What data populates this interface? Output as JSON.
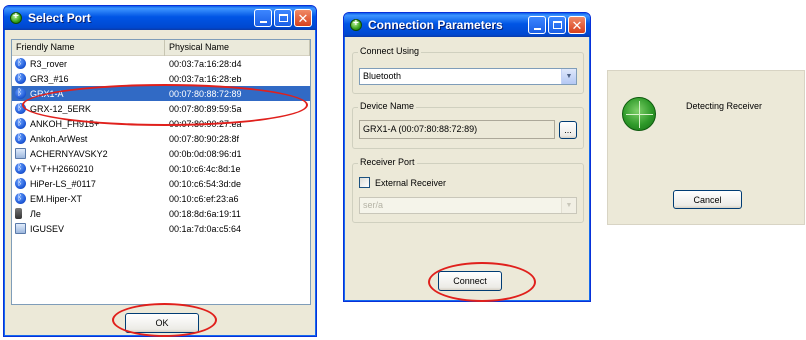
{
  "select_port": {
    "title": "Select Port",
    "columns": [
      "Friendly Name",
      "Physical Name"
    ],
    "rows": [
      {
        "name": "R3_rover",
        "addr": "00:03:7a:16:28:d4",
        "icon": "bluetooth-icon"
      },
      {
        "name": "GR3_#16",
        "addr": "00:03:7a:16:28:eb",
        "icon": "bluetooth-icon"
      },
      {
        "name": "GRX1-A",
        "addr": "00:07:80:88:72:89",
        "icon": "bluetooth-icon",
        "selected": true
      },
      {
        "name": "GRX-12_5ERK",
        "addr": "00:07:80:89:59:5a",
        "icon": "bluetooth-icon"
      },
      {
        "name": "ANKOH_FH915+",
        "addr": "00:07:80:90:27:ea",
        "icon": "bluetooth-icon"
      },
      {
        "name": "Ankoh.ArWest",
        "addr": "00:07:80:90:28:8f",
        "icon": "bluetooth-icon"
      },
      {
        "name": "ACHERNYAVSKY2",
        "addr": "00:0b:0d:08:96:d1",
        "icon": "computer-icon"
      },
      {
        "name": "V+T+H2660210",
        "addr": "00:10:c6:4c:8d:1e",
        "icon": "bluetooth-icon"
      },
      {
        "name": "HiPer-LS_#0117",
        "addr": "00:10:c6:54:3d:de",
        "icon": "bluetooth-icon"
      },
      {
        "name": "EM.Hiper-XT",
        "addr": "00:10:c6:ef:23:a6",
        "icon": "bluetooth-icon"
      },
      {
        "name": "Лe",
        "addr": "00:18:8d:6a:19:11",
        "icon": "phone-icon"
      },
      {
        "name": "IGUSEV",
        "addr": "00:1a:7d:0a:c5:64",
        "icon": "computer-icon"
      }
    ],
    "ok_label": "OK"
  },
  "connection_parameters": {
    "title": "Connection Parameters",
    "connect_using_label": "Connect Using",
    "connect_using_value": "Bluetooth",
    "device_name_label": "Device Name",
    "device_name_value": "GRX1-A (00:07:80:88:72:89)",
    "browse_label": "...",
    "receiver_port_label": "Receiver Port",
    "external_receiver_label": "External Receiver",
    "external_receiver_checked": false,
    "receiver_port_value": "ser/a",
    "connect_label": "Connect"
  },
  "detecting": {
    "text": "Detecting Receiver",
    "cancel_label": "Cancel"
  },
  "colors": {
    "highlight": "#e0201c",
    "selection": "#316ac5",
    "titlebar": "#0055e5"
  }
}
